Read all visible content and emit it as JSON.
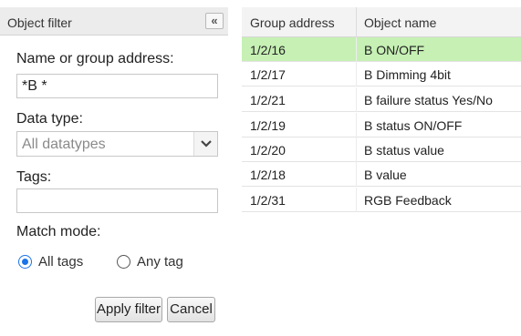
{
  "panel": {
    "title": "Object filter",
    "collapse_glyph": "«",
    "name_label": "Name or group address:",
    "name_value": "*B *",
    "datatype_label": "Data type:",
    "datatype_selected": "All datatypes",
    "tags_label": "Tags:",
    "tags_value": "",
    "match_label": "Match mode:",
    "match_options": [
      {
        "label": "All tags",
        "checked": true
      },
      {
        "label": "Any tag",
        "checked": false
      }
    ],
    "apply_label": "Apply filter",
    "cancel_label": "Cancel"
  },
  "table": {
    "columns": [
      "Group address",
      "Object name"
    ],
    "rows": [
      {
        "address": "1/2/16",
        "name": "B ON/OFF",
        "selected": true
      },
      {
        "address": "1/2/17",
        "name": "B Dimming 4bit",
        "selected": false
      },
      {
        "address": "1/2/21",
        "name": "B failure status Yes/No",
        "selected": false
      },
      {
        "address": "1/2/19",
        "name": "B status ON/OFF",
        "selected": false
      },
      {
        "address": "1/2/20",
        "name": "B status value",
        "selected": false
      },
      {
        "address": "1/2/18",
        "name": "B value",
        "selected": false
      },
      {
        "address": "1/2/31",
        "name": "RGB Feedback",
        "selected": false
      }
    ]
  },
  "colors": {
    "selected_row": "#c6f0b4",
    "radio_accent": "#1a73e8"
  },
  "icons": {
    "collapse": "double-chevron-left-icon",
    "dropdown": "chevron-down-icon"
  }
}
